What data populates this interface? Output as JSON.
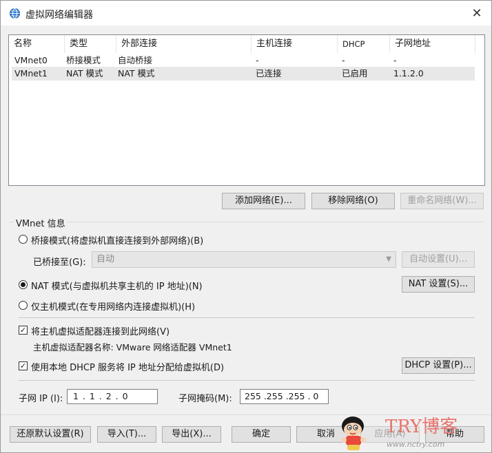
{
  "window": {
    "title": "虚拟网络编辑器",
    "close_glyph": "✕"
  },
  "table": {
    "columns": [
      "名称",
      "类型",
      "外部连接",
      "主机连接",
      "DHCP",
      "子网地址"
    ],
    "rows": [
      [
        "VMnet0",
        "桥接模式",
        "自动桥接",
        "-",
        "-",
        "-"
      ],
      [
        "VMnet1",
        "NAT 模式",
        "NAT 模式",
        "已连接",
        "已启用",
        "1.1.2.0"
      ]
    ],
    "selected_row": 1
  },
  "network_buttons": {
    "add": "添加网络(E)...",
    "remove": "移除网络(O)",
    "rename": "重命名网络(W)..."
  },
  "vmnet_info": {
    "group_label": "VMnet 信息",
    "bridged_label": "桥接模式(将虚拟机直接连接到外部网络)(B)",
    "bridged_to_label": "已桥接至(G):",
    "bridged_to_value": "自动",
    "auto_settings": "自动设置(U)...",
    "nat_label": "NAT 模式(与虚拟机共享主机的 IP 地址)(N)",
    "nat_settings": "NAT 设置(S)...",
    "host_only_label": "仅主机模式(在专用网络内连接虚拟机)(H)",
    "selected_mode": "nat",
    "connect_adapter_label": "将主机虚拟适配器连接到此网络(V)",
    "connect_adapter_checked": true,
    "adapter_name_label": "主机虚拟适配器名称: VMware 网络适配器 VMnet1",
    "dhcp_label": "使用本地 DHCP 服务将 IP 地址分配给虚拟机(D)",
    "dhcp_checked": true,
    "dhcp_settings": "DHCP 设置(P)...",
    "subnet_ip_label": "子网 IP (I):",
    "subnet_ip_value": "1 . 1 . 2 . 0",
    "subnet_mask_label": "子网掩码(M):",
    "subnet_mask_value": "255 .255 .255 . 0"
  },
  "footer": {
    "restore": "还原默认设置(R)",
    "import": "导入(T)...",
    "export": "导出(X)...",
    "ok": "确定",
    "cancel": "取消",
    "apply": "应用(A)",
    "help": "帮助"
  },
  "watermark": {
    "brand": "TRY博客",
    "url": "www.nctry.com"
  },
  "icons": {
    "title": "network-globe-icon",
    "close": "close-icon",
    "dropdown": "chevron-down-icon"
  },
  "colors": {
    "window_bg": "#f0f0f0",
    "selected_row": "#e8e8e8",
    "watermark": "#e8736b"
  }
}
